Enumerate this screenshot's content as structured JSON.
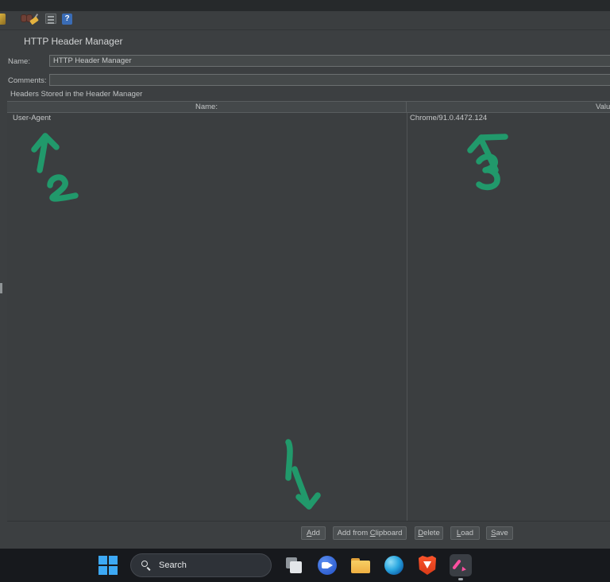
{
  "toolbar": {
    "icons": [
      "brush-icon",
      "binoculars-icon",
      "broom-icon",
      "list-icon",
      "help-icon"
    ],
    "help_glyph": "?"
  },
  "panel": {
    "title": "HTTP Header Manager",
    "name_label": "Name:",
    "name_value": "HTTP Header Manager",
    "comments_label": "Comments:",
    "comments_value": "",
    "headers_section_label": "Headers Stored in the Header Manager",
    "table": {
      "columns": [
        "Name:",
        "Value"
      ],
      "rows": [
        {
          "name": "User-Agent",
          "value": "Chrome/91.0.4472.124"
        }
      ]
    },
    "buttons": [
      {
        "label": "Add",
        "mnemonic": 0
      },
      {
        "label": "Add from Clipboard",
        "mnemonic": 9
      },
      {
        "label": "Delete",
        "mnemonic": 0
      },
      {
        "label": "Load",
        "mnemonic": 0
      },
      {
        "label": "Save",
        "mnemonic": 0
      }
    ]
  },
  "annotations": {
    "color": "#21996b",
    "labels": [
      "1",
      "2",
      "3"
    ]
  },
  "taskbar": {
    "search_label": "Search",
    "icons": [
      "start-icon",
      "task-view-icon",
      "chat-icon",
      "file-explorer-icon",
      "edge-icon",
      "brave-icon",
      "pen-app-icon"
    ]
  }
}
